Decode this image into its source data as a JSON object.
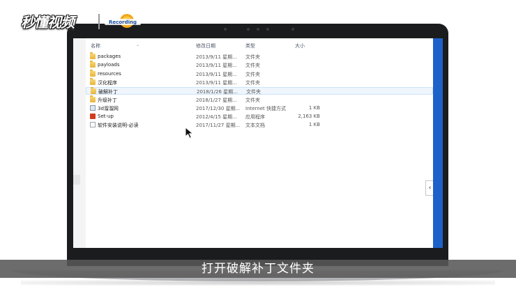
{
  "watermark": {
    "logo_text": "秒懂视频",
    "badge_text": "Recording"
  },
  "explorer": {
    "columns": {
      "name": "名称",
      "date": "修改日期",
      "type": "类型",
      "size": "大小"
    },
    "rows": [
      {
        "name": "packages",
        "date": "2013/9/11 星期...",
        "type": "文件夹",
        "size": "",
        "icon": "folder-icon"
      },
      {
        "name": "payloads",
        "date": "2013/9/11 星期...",
        "type": "文件夹",
        "size": "",
        "icon": "folder-icon"
      },
      {
        "name": "resources",
        "date": "2013/9/11 星期...",
        "type": "文件夹",
        "size": "",
        "icon": "folder-icon"
      },
      {
        "name": "汉化程序",
        "date": "2013/9/11 星期...",
        "type": "文件夹",
        "size": "",
        "icon": "folder-icon"
      },
      {
        "name": "破解补丁",
        "date": "2018/1/26 星期...",
        "type": "文件夹",
        "size": "",
        "icon": "folder-icon"
      },
      {
        "name": "升级补丁",
        "date": "2018/1/27 星期...",
        "type": "文件夹",
        "size": "",
        "icon": "folder-icon"
      },
      {
        "name": "3d溜溜网",
        "date": "2017/12/30 星期...",
        "type": "Internet 快捷方式",
        "size": "1 KB",
        "icon": "shortcut-icon"
      },
      {
        "name": "Set-up",
        "date": "2012/4/15 星期...",
        "type": "应用程序",
        "size": "2,163 KB",
        "icon": "app-icon"
      },
      {
        "name": "软件安装说明-必读",
        "date": "2017/11/27 星期...",
        "type": "文本文档",
        "size": "1 KB",
        "icon": "document-icon"
      }
    ],
    "hovered_row": 4,
    "collapse_tab_glyph": "‹"
  },
  "subtitle": "打开破解补丁文件夹",
  "colors": {
    "taskbar": "#1d62c8",
    "hover": "#eef5fc",
    "subtitle_bg": "#585858"
  }
}
